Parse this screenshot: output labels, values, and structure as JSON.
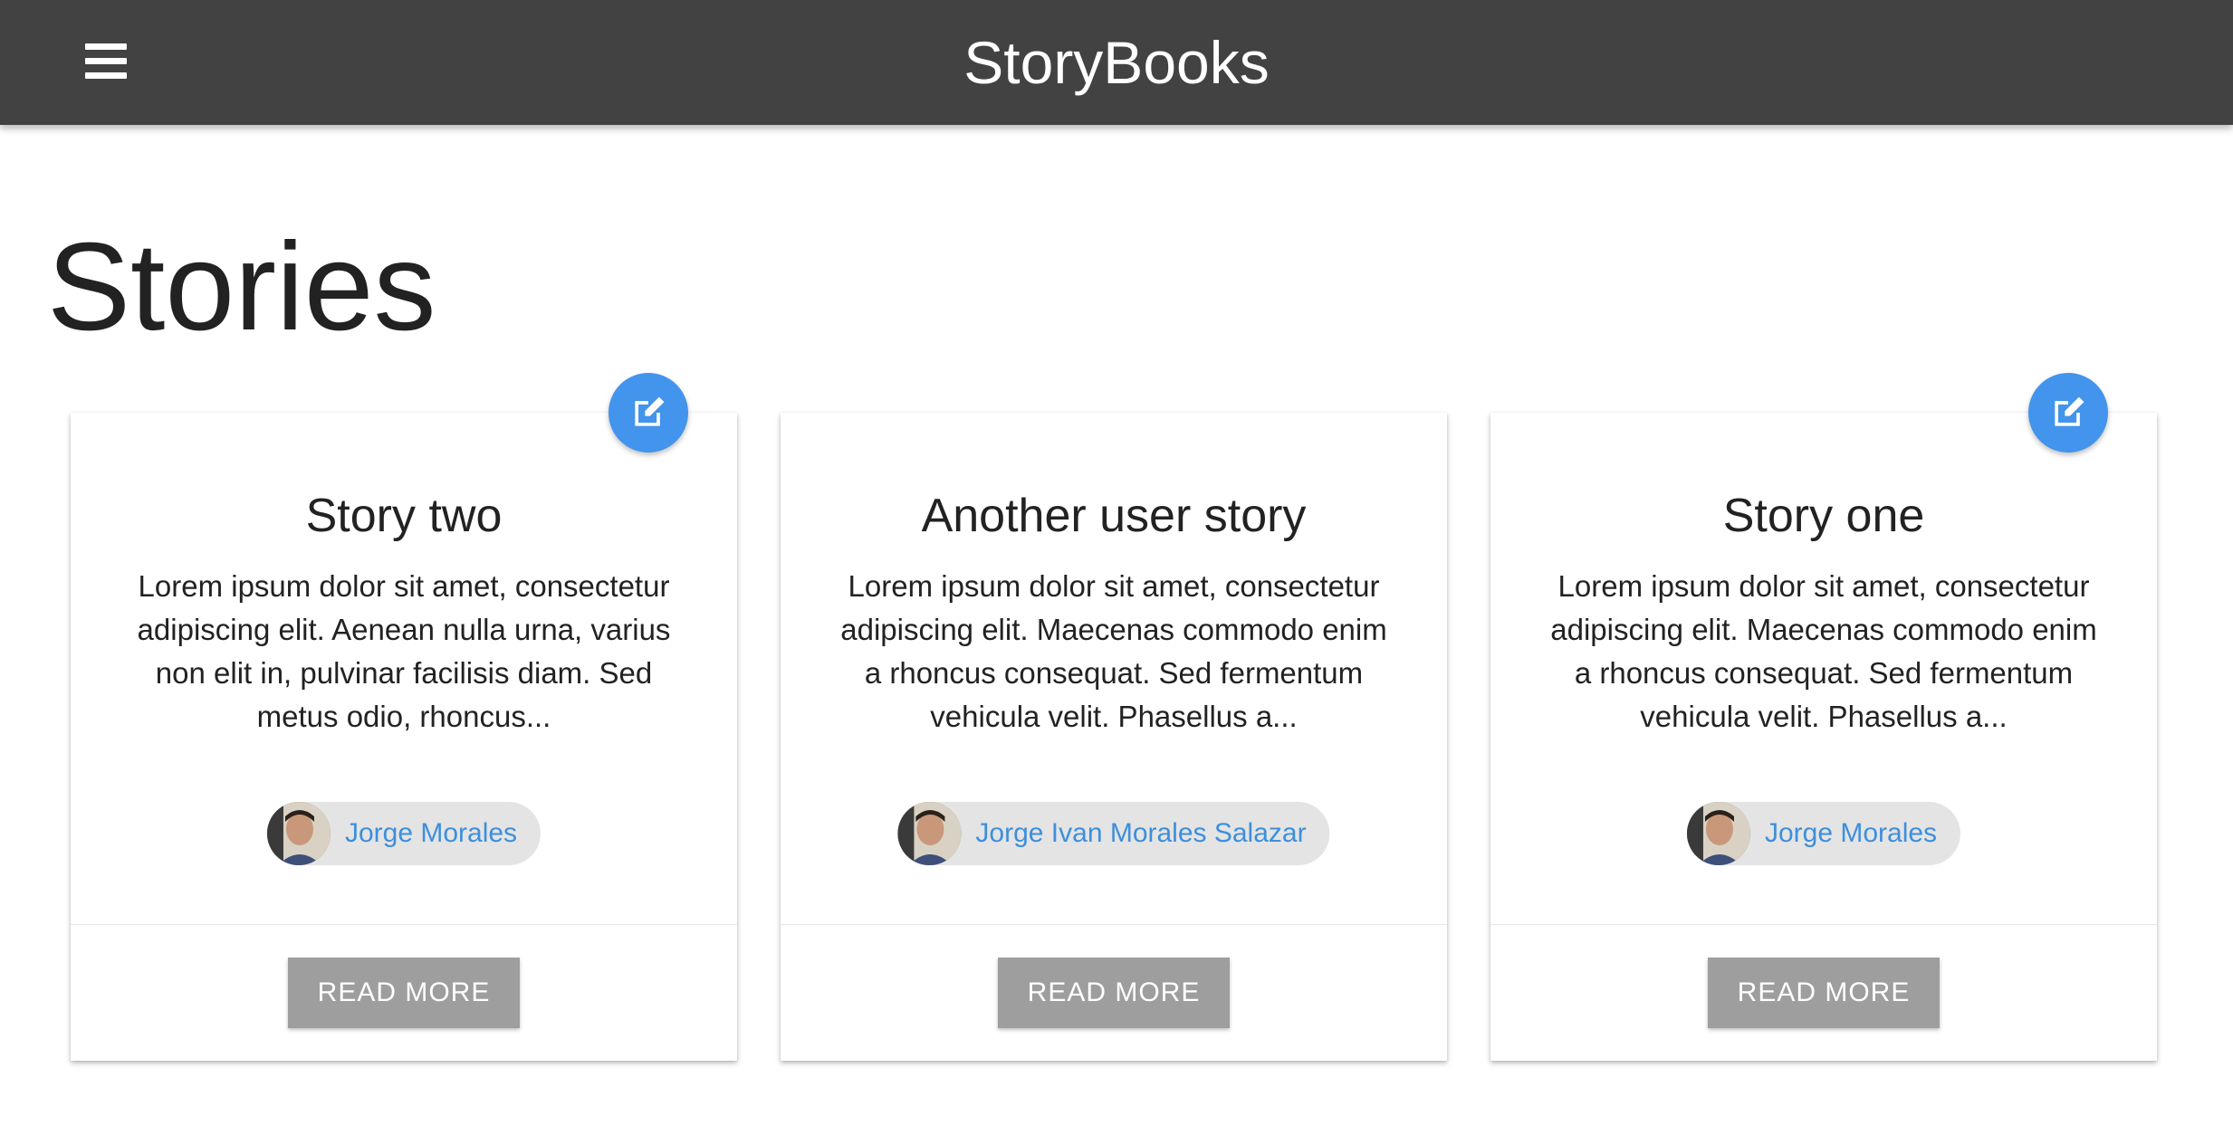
{
  "navbar": {
    "brand": "StoryBooks",
    "menu_icon": "hamburger-menu-icon",
    "background_color": "#424242"
  },
  "page": {
    "title": "Stories"
  },
  "colors": {
    "accent": "#4294ec",
    "link": "#3d8fdc",
    "chip_bg": "#e4e4e4",
    "button_bg": "#9e9e9e"
  },
  "stories": [
    {
      "title": "Story two",
      "excerpt": "Lorem ipsum dolor sit amet, consectetur adipiscing elit. Aenean nulla urna, varius non elit in, pulvinar facilisis diam. Sed metus odio, rhoncus...",
      "author": "Jorge Morales",
      "editable": true,
      "action_label": "READ MORE"
    },
    {
      "title": "Another user story",
      "excerpt": "Lorem ipsum dolor sit amet, consectetur adipiscing elit. Maecenas commodo enim a rhoncus consequat. Sed fermentum vehicula velit. Phasellus a...",
      "author": "Jorge Ivan Morales Salazar",
      "editable": false,
      "action_label": "READ MORE"
    },
    {
      "title": "Story one",
      "excerpt": "Lorem ipsum dolor sit amet, consectetur adipiscing elit. Maecenas commodo enim a rhoncus consequat. Sed fermentum vehicula velit. Phasellus a...",
      "author": "Jorge Morales",
      "editable": true,
      "action_label": "READ MORE"
    }
  ]
}
